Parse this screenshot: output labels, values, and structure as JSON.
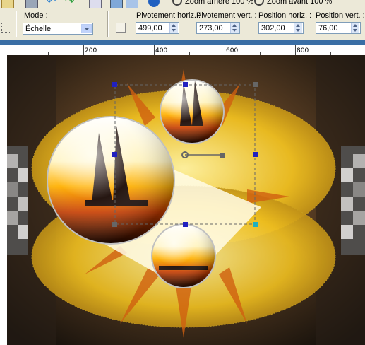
{
  "toolbar": {
    "zoom_out_label": "Zoom arrière 100 %",
    "zoom_in_label": "Zoom avant 100 %"
  },
  "options": {
    "mode_label": "Mode :",
    "mode_value": "Échelle",
    "pivot_h_label": "Pivotement horiz. :",
    "pivot_h_value": "499,00",
    "pivot_v_label": "Pivotement vert. :",
    "pivot_v_value": "273,00",
    "pos_h_label": "Position horiz. :",
    "pos_h_value": "302,00",
    "pos_v_label": "Position vert. :",
    "pos_v_value": "76,00"
  },
  "ruler": {
    "marks": [
      "200",
      "400",
      "600",
      "800"
    ]
  },
  "colors": {
    "accent": "#3a6ea5",
    "canvas_dark": "#1a1410",
    "gold": "#f5d020",
    "orange": "#e07010"
  }
}
